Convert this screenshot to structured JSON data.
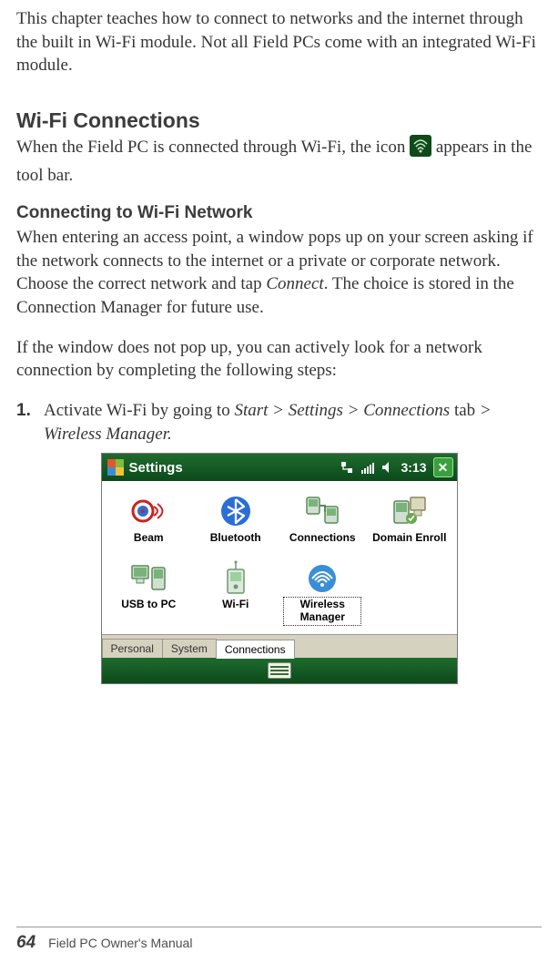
{
  "intro": "This chapter teaches how to connect to networks and the internet through the built in Wi-Fi module. Not all Field PCs come with an integrated Wi-Fi module.",
  "section1": {
    "heading": "Wi-Fi Connections",
    "para_pre": "When the Field PC is connected through Wi-Fi, the icon ",
    "para_post": " appears in the tool bar."
  },
  "section2": {
    "heading": "Connecting to Wi-Fi Network",
    "para1_a": "When entering an access point, a window pops up on your screen asking if the network connects to the internet or a private or corporate network. Choose the correct network and tap ",
    "para1_connect": "Connect",
    "para1_b": ". The choice is stored in the Connection Manager for future use.",
    "para2": "If the window does not pop up, you can actively look for a network connection by completing the following steps:",
    "step1": {
      "num": "1.",
      "a": "Activate Wi-Fi by going to ",
      "path": "Start > Settings > Connections",
      "b": " tab ",
      "path2": "> Wireless Manager."
    }
  },
  "wm": {
    "title": "Settings",
    "time": "3:13",
    "close": "✕",
    "items": [
      {
        "label": "Beam"
      },
      {
        "label": "Bluetooth"
      },
      {
        "label": "Connections"
      },
      {
        "label": "Domain Enroll"
      },
      {
        "label": "USB to PC"
      },
      {
        "label": "Wi-Fi"
      },
      {
        "label": "Wireless Manager",
        "selected": true
      }
    ],
    "tabs": [
      {
        "label": "Personal",
        "active": false
      },
      {
        "label": "System",
        "active": false
      },
      {
        "label": "Connections",
        "active": true
      }
    ]
  },
  "footer": {
    "page": "64",
    "title": "Field PC Owner's Manual"
  }
}
